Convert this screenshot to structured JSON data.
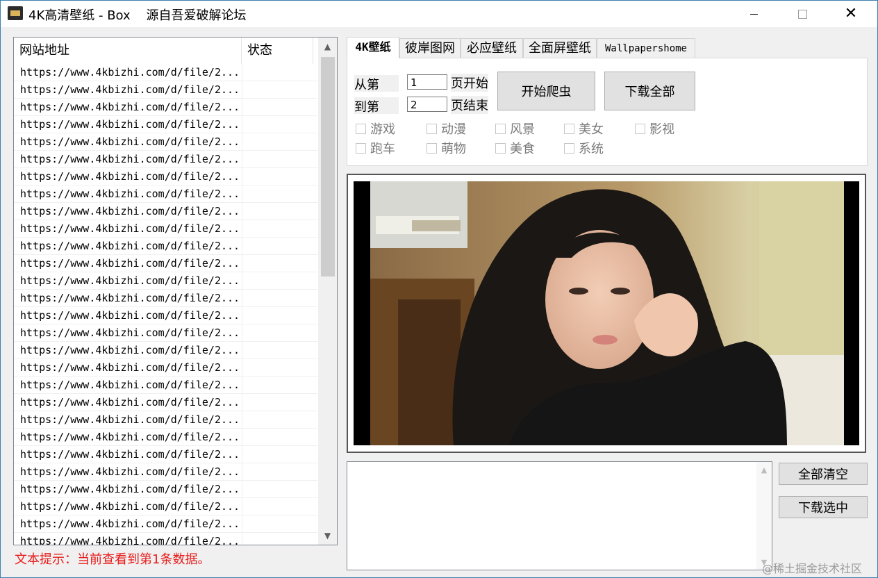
{
  "window": {
    "title": "4K高清壁纸 - Box    源自吾爱破解论坛",
    "minimize": "",
    "close": "✕"
  },
  "list": {
    "columns": [
      "网站地址",
      "状态"
    ],
    "row_text": "https://www.4kbizhi.com/d/file/2...",
    "rows": [
      {
        "url": "https://www.4kbizhi.com/d/file/2...",
        "status": ""
      },
      {
        "url": "https://www.4kbizhi.com/d/file/2...",
        "status": ""
      },
      {
        "url": "https://www.4kbizhi.com/d/file/2...",
        "status": ""
      },
      {
        "url": "https://www.4kbizhi.com/d/file/2...",
        "status": ""
      },
      {
        "url": "https://www.4kbizhi.com/d/file/2...",
        "status": ""
      },
      {
        "url": "https://www.4kbizhi.com/d/file/2...",
        "status": ""
      },
      {
        "url": "https://www.4kbizhi.com/d/file/2...",
        "status": ""
      },
      {
        "url": "https://www.4kbizhi.com/d/file/2...",
        "status": ""
      },
      {
        "url": "https://www.4kbizhi.com/d/file/2...",
        "status": ""
      },
      {
        "url": "https://www.4kbizhi.com/d/file/2...",
        "status": ""
      },
      {
        "url": "https://www.4kbizhi.com/d/file/2...",
        "status": ""
      },
      {
        "url": "https://www.4kbizhi.com/d/file/2...",
        "status": ""
      },
      {
        "url": "https://www.4kbizhi.com/d/file/2...",
        "status": ""
      },
      {
        "url": "https://www.4kbizhi.com/d/file/2...",
        "status": ""
      },
      {
        "url": "https://www.4kbizhi.com/d/file/2...",
        "status": ""
      },
      {
        "url": "https://www.4kbizhi.com/d/file/2...",
        "status": ""
      },
      {
        "url": "https://www.4kbizhi.com/d/file/2...",
        "status": ""
      },
      {
        "url": "https://www.4kbizhi.com/d/file/2...",
        "status": ""
      },
      {
        "url": "https://www.4kbizhi.com/d/file/2...",
        "status": ""
      },
      {
        "url": "https://www.4kbizhi.com/d/file/2...",
        "status": ""
      },
      {
        "url": "https://www.4kbizhi.com/d/file/2...",
        "status": ""
      },
      {
        "url": "https://www.4kbizhi.com/d/file/2...",
        "status": ""
      },
      {
        "url": "https://www.4kbizhi.com/d/file/2...",
        "status": ""
      },
      {
        "url": "https://www.4kbizhi.com/d/file/2...",
        "status": ""
      },
      {
        "url": "https://www.4kbizhi.com/d/file/2...",
        "status": ""
      },
      {
        "url": "https://www.4kbizhi.com/d/file/2...",
        "status": ""
      },
      {
        "url": "https://www.4kbizhi.com/d/file/2...",
        "status": ""
      },
      {
        "url": "https://www.4kbizhi.com/d/file/2...",
        "status": ""
      },
      {
        "url": "https://www.4kbizhi.com/d/file/2...",
        "status": ""
      },
      {
        "url": "https://www.4kbizhi.com/d/file/2...",
        "status": ""
      }
    ]
  },
  "hint": "文本提示：当前查看到第1条数据。",
  "tabs": [
    "4K壁纸",
    "彼岸图网",
    "必应壁纸",
    "全面屏壁纸",
    "Wallpapershome"
  ],
  "crawl": {
    "from_label": "从第",
    "to_label": "到第",
    "from_value": "1",
    "to_value": "2",
    "start_suffix": "页开始",
    "end_suffix": "页结束",
    "start_button": "开始爬虫",
    "download_all_button": "下载全部"
  },
  "categories": [
    "游戏",
    "动漫",
    "风景",
    "美女",
    "影视",
    "跑车",
    "萌物",
    "美食",
    "系统"
  ],
  "actions": {
    "clear_all": "全部清空",
    "download_selected": "下载选中"
  },
  "watermark": "@稀土掘金技术社区",
  "colors": {
    "hint_red": "#e81b1b",
    "window_border": "#3c7fb1",
    "button_face": "#e1e1e1"
  }
}
